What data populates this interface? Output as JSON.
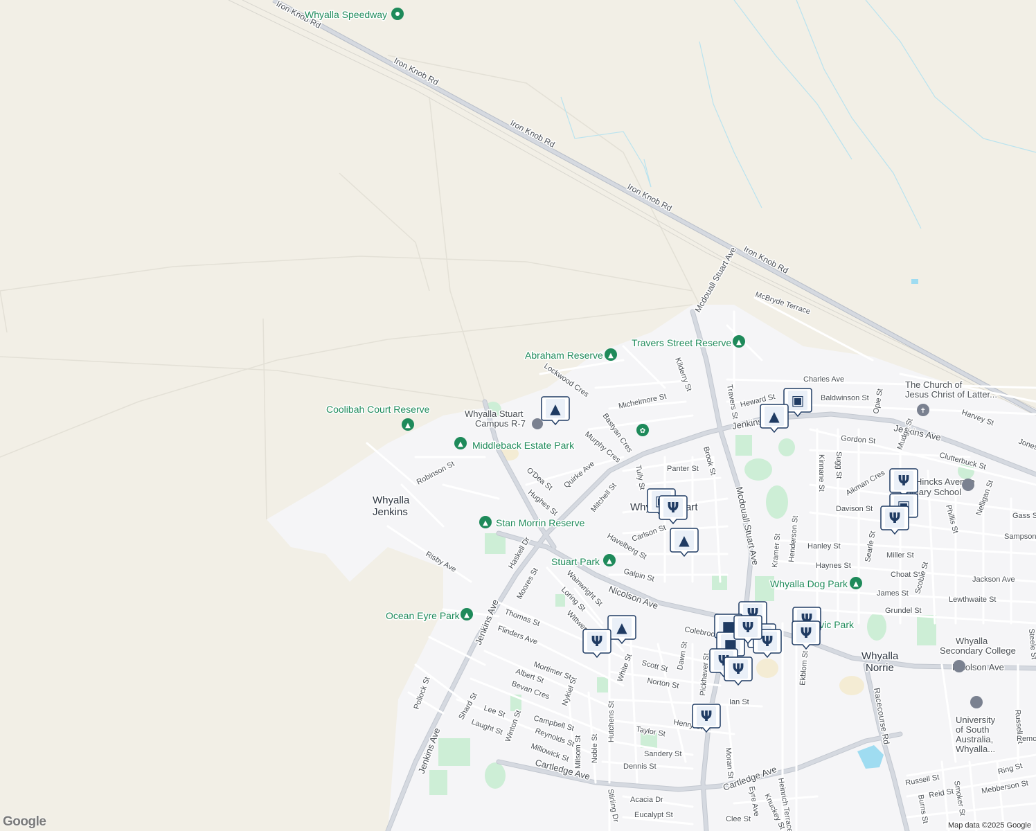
{
  "map": {
    "attribution": "Map data ©2025 Google",
    "logo": "Google",
    "colors": {
      "land": "#f2efe6",
      "urban": "#f5f5f7",
      "road": "#ffffff",
      "road_casing": "#c9ccd3",
      "highway": "#d5d9e0",
      "park": "#cdeed6",
      "water": "#9fdcf1",
      "poi_green": "#1e8a5a",
      "poi_blue": "#1f3b63",
      "label": "#4a4f55"
    },
    "roads": [
      "Iron Knob Rd",
      "Iron Knob Rd",
      "Iron Knob Rd",
      "Iron Knob Rd",
      "Iron Knob Rd",
      "Mcdouall Stuart Ave",
      "McBryde Terrace",
      "Charles Ave",
      "Heward St",
      "Baldwinson St",
      "Opie St",
      "Harvey St",
      "Jones St",
      "Travers St",
      "Kilderry St",
      "Lockwood Cres",
      "Michelmore St",
      "Bastyan Cres",
      "Murphy Cres",
      "Jenkins Ave",
      "Jenkins Ave",
      "Gordon St",
      "Clutterbuck St",
      "Robinson St",
      "O'Dea St",
      "Quirke Ave",
      "Tully St",
      "Panter St",
      "Brook St",
      "Mcdouall Stuart Ave",
      "Hughes St",
      "Mitchell St",
      "Kinnane St",
      "Sugg St",
      "Aikman Cres",
      "Mudge St",
      "Davison St",
      "Gass St",
      "Phillis St",
      "Nelligan St",
      "Sampson St",
      "Carlson St",
      "Hanley St",
      "Miller St",
      "Havelberg St",
      "Haynes St",
      "Choat St",
      "Scoble St",
      "Jackson Ave",
      "Risby Ave",
      "Haskell Dr",
      "Galpin St",
      "Kramer St",
      "Henderson St",
      "Searle St",
      "James St",
      "Lewthwaite St",
      "Moores St",
      "Wainwright St",
      "Loring St",
      "Nicolson Ave",
      "Grundel St",
      "Thomas St",
      "Jenkins Ave",
      "Wittwer St",
      "Colebrook St",
      "Flinders Ave",
      "Ekblom St",
      "Dawn St",
      "Scott St",
      "Pickhaver St",
      "Mortimer St",
      "Albert St",
      "White St",
      "Norton St",
      "Nicolson Ave",
      "Racecourse Rd",
      "Russell St",
      "Pollock St",
      "Bevan Cres",
      "Nykiel St",
      "Ian St",
      "Shard St",
      "Lee St",
      "Campbell St",
      "Hutchens St",
      "Henry St",
      "Laught St",
      "Winton St",
      "Reynolds St",
      "Taylor St",
      "Millowick St",
      "Milsom St",
      "Noble St",
      "Sandery St",
      "Dennis St",
      "Jenkins Ave",
      "Moran St",
      "Cartledge Ave",
      "Cartledge Ave",
      "Heinrich Terrace",
      "Russell St",
      "Ring St",
      "Reid St",
      "Smoker St",
      "Burns St",
      "Mebberson St",
      "Acacia Dr",
      "Stirling Dr",
      "Eucalypt St",
      "Eyre Ave",
      "Knuckey St",
      "Clee St",
      "Remo St",
      "Steele St"
    ],
    "places": [
      "Whyalla Speedway",
      "Travers Street Reserve",
      "Abraham Reserve",
      "Coolibah Court Reserve",
      "Whyalla Stuart Campus R-7",
      "Middleback Estate Park",
      "Whyalla Jenkins",
      "Whyalla Stuart",
      "Stan Morrin Reserve",
      "Stuart Park",
      "Whyalla Dog Park",
      "Ocean Eyre Park",
      "Civic Park",
      "Whyalla Norrie",
      "Whyalla Secondary College",
      "University of South Australia, Whyalla...",
      "The Church of Jesus Christ of Latter...",
      "Hincks Avenue Primary School"
    ],
    "pins": [
      "school",
      "shopping-cart",
      "school",
      "shopping-cart",
      "restaurant",
      "restaurant",
      "shopping-cart",
      "restaurant",
      "school",
      "restaurant",
      "school",
      "restaurant",
      "shopping-bag",
      "restaurant",
      "shopping-bag",
      "restaurant",
      "restaurant",
      "restaurant",
      "restaurant",
      "restaurant",
      "restaurant",
      "restaurant"
    ]
  }
}
